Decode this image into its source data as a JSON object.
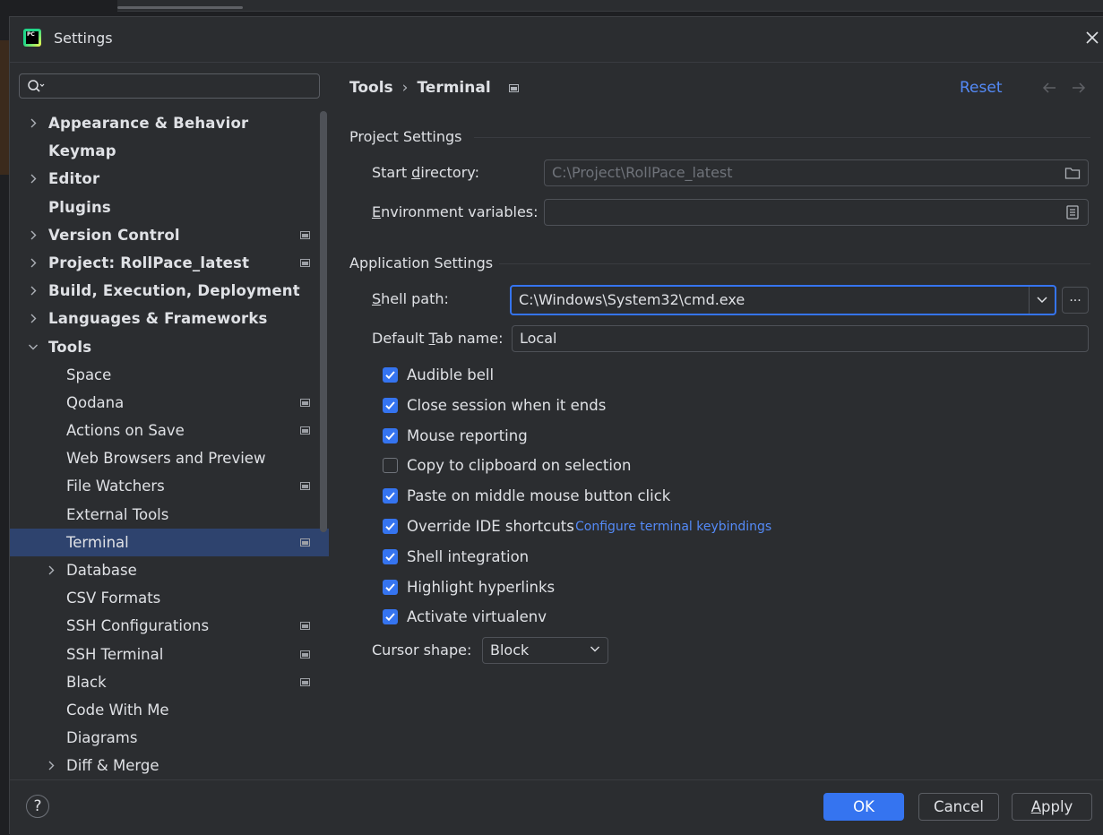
{
  "window": {
    "title": "Settings"
  },
  "search": {
    "placeholder": ""
  },
  "tree": [
    {
      "label": "Appearance & Behavior",
      "level": 0,
      "expandable": true,
      "expanded": false,
      "project": false
    },
    {
      "label": "Keymap",
      "level": 0,
      "expandable": false,
      "project": false
    },
    {
      "label": "Editor",
      "level": 0,
      "expandable": true,
      "expanded": false,
      "project": false
    },
    {
      "label": "Plugins",
      "level": 0,
      "expandable": false,
      "project": false
    },
    {
      "label": "Version Control",
      "level": 0,
      "expandable": true,
      "expanded": false,
      "project": true
    },
    {
      "label": "Project: RollPace_latest",
      "level": 0,
      "expandable": true,
      "expanded": false,
      "project": true
    },
    {
      "label": "Build, Execution, Deployment",
      "level": 0,
      "expandable": true,
      "expanded": false,
      "project": false
    },
    {
      "label": "Languages & Frameworks",
      "level": 0,
      "expandable": true,
      "expanded": false,
      "project": false
    },
    {
      "label": "Tools",
      "level": 0,
      "expandable": true,
      "expanded": true,
      "project": false
    },
    {
      "label": "Space",
      "level": 1,
      "expandable": false,
      "project": false
    },
    {
      "label": "Qodana",
      "level": 1,
      "expandable": false,
      "project": true
    },
    {
      "label": "Actions on Save",
      "level": 1,
      "expandable": false,
      "project": true
    },
    {
      "label": "Web Browsers and Preview",
      "level": 1,
      "expandable": false,
      "project": false
    },
    {
      "label": "File Watchers",
      "level": 1,
      "expandable": false,
      "project": true
    },
    {
      "label": "External Tools",
      "level": 1,
      "expandable": false,
      "project": false
    },
    {
      "label": "Terminal",
      "level": 1,
      "expandable": false,
      "project": true,
      "selected": true
    },
    {
      "label": "Database",
      "level": 1,
      "expandable": true,
      "expanded": false,
      "project": false
    },
    {
      "label": "CSV Formats",
      "level": 1,
      "expandable": false,
      "project": false
    },
    {
      "label": "SSH Configurations",
      "level": 1,
      "expandable": false,
      "project": true
    },
    {
      "label": "SSH Terminal",
      "level": 1,
      "expandable": false,
      "project": true
    },
    {
      "label": "Black",
      "level": 1,
      "expandable": false,
      "project": true
    },
    {
      "label": "Code With Me",
      "level": 1,
      "expandable": false,
      "project": false
    },
    {
      "label": "Diagrams",
      "level": 1,
      "expandable": false,
      "project": false
    },
    {
      "label": "Diff & Merge",
      "level": 1,
      "expandable": true,
      "expanded": false,
      "project": false
    }
  ],
  "breadcrumb": {
    "parent": "Tools",
    "separator": "›",
    "current": "Terminal"
  },
  "header": {
    "reset_label": "Reset"
  },
  "project_settings": {
    "title": "Project Settings",
    "start_directory": {
      "label_pre": "Start ",
      "label_u": "d",
      "label_post": "irectory:",
      "value": "C:\\Project\\RollPace_latest"
    },
    "env_vars": {
      "label_pre": "",
      "label_u": "E",
      "label_post": "nvironment variables:",
      "value": ""
    }
  },
  "app_settings": {
    "title": "Application Settings",
    "shell_path": {
      "label_pre": "",
      "label_u": "S",
      "label_post": "hell path:",
      "value": "C:\\Windows\\System32\\cmd.exe",
      "browse_label": "..."
    },
    "tab_name": {
      "label_pre": "Default ",
      "label_u": "T",
      "label_post": "ab name:",
      "value": "Local"
    },
    "checkboxes": [
      {
        "label": "Audible bell",
        "checked": true
      },
      {
        "label": "Close session when it ends",
        "checked": true
      },
      {
        "label": "Mouse reporting",
        "checked": true
      },
      {
        "label": "Copy to clipboard on selection",
        "checked": false
      },
      {
        "label": "Paste on middle mouse button click",
        "checked": true
      },
      {
        "label": "Override IDE shortcuts",
        "checked": true,
        "link": "Configure terminal keybindings"
      },
      {
        "label": "Shell integration",
        "checked": true
      },
      {
        "label": "Highlight hyperlinks",
        "checked": true
      },
      {
        "label": "Activate virtualenv",
        "checked": true
      }
    ],
    "cursor_shape": {
      "label": "Cursor shape:",
      "value": "Block"
    }
  },
  "footer": {
    "help_label": "?",
    "ok_label": "OK",
    "cancel_label": "Cancel",
    "apply_pre": "",
    "apply_u": "A",
    "apply_post": "pply"
  },
  "colors": {
    "accent": "#3574f0",
    "link": "#548af7",
    "selected_row": "#2e436e",
    "background": "#2b2d30"
  },
  "icons": [
    "app-icon",
    "close-icon",
    "search-icon",
    "chevron-right-icon",
    "chevron-down-icon",
    "project-level-icon",
    "folder-icon",
    "document-icon",
    "back-arrow-icon",
    "forward-arrow-icon",
    "checkmark-icon"
  ]
}
